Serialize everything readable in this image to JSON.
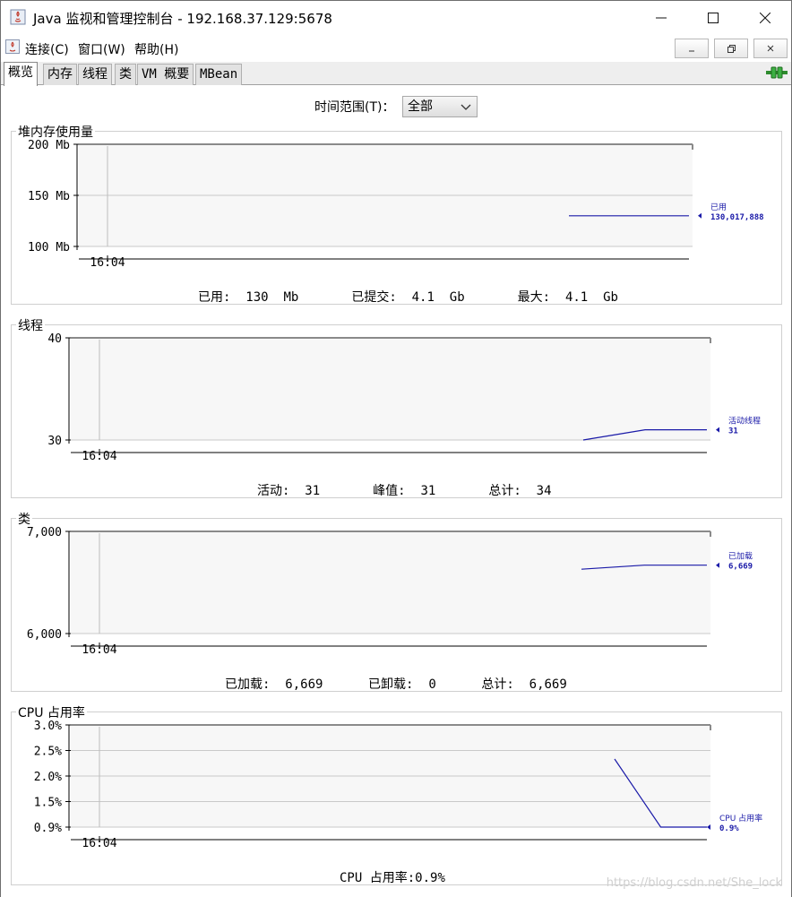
{
  "window": {
    "title": "Java 监视和管理控制台 - 192.168.37.129:5678",
    "minimize_icon": "minimize-icon",
    "maximize_icon": "maximize-icon",
    "close_icon": "close-icon"
  },
  "menu": {
    "items": [
      "连接(C)",
      "窗口(W)",
      "帮助(H)"
    ],
    "inner_buttons": [
      "minimize-icon",
      "restore-icon",
      "close-icon"
    ]
  },
  "tabs": [
    {
      "label": "概览",
      "active": true
    },
    {
      "label": "内存",
      "active": false
    },
    {
      "label": "线程",
      "active": false
    },
    {
      "label": "类",
      "active": false
    },
    {
      "label": "VM 概要",
      "active": false
    },
    {
      "label": "MBean",
      "active": false
    }
  ],
  "connection_icon": "connected-plug-icon",
  "time_range": {
    "label": "时间范围(T)：",
    "selected": "全部"
  },
  "colors": {
    "series": "#1a1aa8",
    "grid": "#c9c9c9",
    "plot_bg": "#f7f7f7"
  },
  "panels": {
    "heap": {
      "title": "堆内存使用量",
      "summary": [
        {
          "label": "已用:",
          "value": "130  Mb"
        },
        {
          "label": "已提交:",
          "value": "4.1  Gb"
        },
        {
          "label": "最大:",
          "value": "4.1  Gb"
        }
      ]
    },
    "threads": {
      "title": "线程",
      "summary": [
        {
          "label": "活动:",
          "value": "31"
        },
        {
          "label": "峰值:",
          "value": "31"
        },
        {
          "label": "总计:",
          "value": "34"
        }
      ]
    },
    "classes": {
      "title": "类",
      "summary": [
        {
          "label": "已加载:",
          "value": "6,669"
        },
        {
          "label": "已卸载:",
          "value": "0"
        },
        {
          "label": "总计:",
          "value": "6,669"
        }
      ]
    },
    "cpu": {
      "title": "CPU 占用率",
      "summary": [
        {
          "label": "CPU 占用率:",
          "value": "0.9%"
        }
      ]
    }
  },
  "chart_data": [
    {
      "type": "line",
      "title": "堆内存使用量",
      "yticks": [
        "200 Mb",
        "150 Mb",
        "100 Mb"
      ],
      "ylim": [
        100,
        200
      ],
      "xtick": "16:04",
      "series": [
        {
          "name": "已用",
          "value_label": "130,017,888",
          "points": [
            130,
            130
          ]
        }
      ]
    },
    {
      "type": "line",
      "title": "线程",
      "yticks": [
        "40",
        "30"
      ],
      "ylim": [
        30,
        40
      ],
      "xtick": "16:04",
      "series": [
        {
          "name": "活动线程",
          "value_label": "31",
          "points": [
            30,
            31,
            31
          ]
        }
      ]
    },
    {
      "type": "line",
      "title": "类",
      "yticks": [
        "7,000",
        "6,000"
      ],
      "ylim": [
        6000,
        7000
      ],
      "xtick": "16:04",
      "series": [
        {
          "name": "已加载",
          "value_label": "6,669",
          "points": [
            6630,
            6669,
            6669
          ]
        }
      ]
    },
    {
      "type": "line",
      "title": "CPU 占用率",
      "yticks": [
        "3.0%",
        "2.5%",
        "2.0%",
        "1.5%",
        "0.9%"
      ],
      "ylim": [
        0.9,
        3.0
      ],
      "xtick": "16:04",
      "series": [
        {
          "name": "CPU 占用率",
          "value_label": "0.9%",
          "points": [
            2.3,
            0.9,
            0.9
          ]
        }
      ]
    }
  ],
  "watermark": "https://blog.csdn.net/She_lock"
}
